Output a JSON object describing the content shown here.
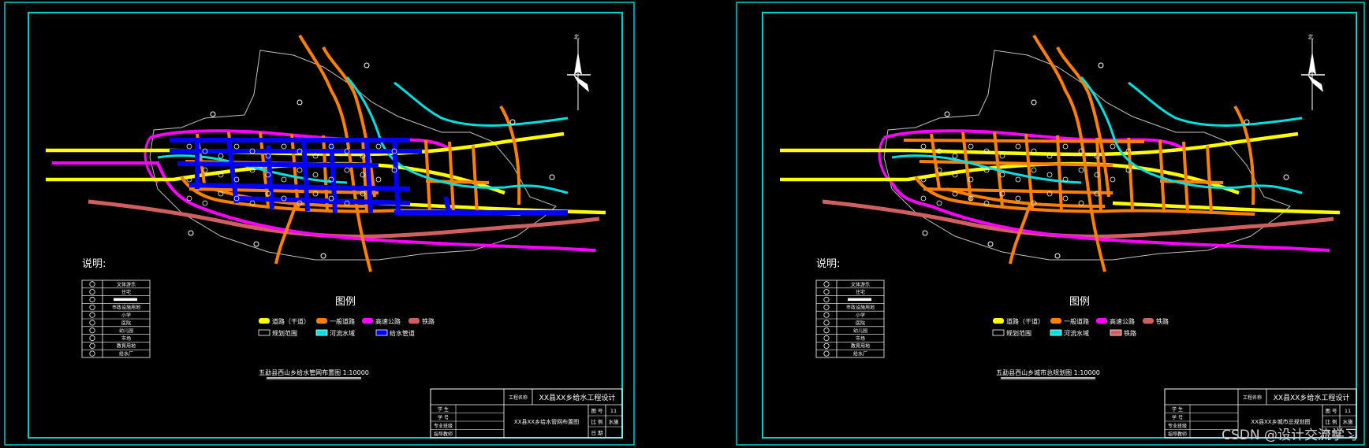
{
  "colors": {
    "frame": "#00d0d0",
    "trunk_road": "#ffff00",
    "general_road": "#ff8000",
    "expressway": "#ff00ff",
    "railway": "#d06060",
    "river": "#00e0e0",
    "water_pipe": "#0000ff",
    "boundary": "#c0c0c0"
  },
  "compass_label": "北",
  "notes_label": "说明:",
  "legend_title": "图例",
  "legend_items": {
    "trunk_road": "道路（干道）",
    "general_road": "一般道路",
    "expressway": "高速公路",
    "railway": "铁路",
    "boundary": "规划范围",
    "river": "河流水域",
    "water_pipe": "给水管道"
  },
  "facility_list": [
    "文体游乐",
    "住宅",
    "",
    "市政设施用地",
    "小学",
    "医院",
    "幼儿园",
    "市场",
    "教育用地",
    "给水厂"
  ],
  "left_sheet": {
    "drawing_caption": "五勐县西山乡给水管网布置图 1:10000",
    "project_label": "工程名称",
    "project_name": "XX县XX乡给水工程设计",
    "drawing_name": "XX县XX乡给水管网布置图",
    "roles": [
      "学 生",
      "学 号",
      "专业班级",
      "指导教师"
    ],
    "meta_labels": [
      "图 号",
      "比 例",
      "日 期"
    ],
    "meta_values": [
      "11",
      "水施",
      ""
    ]
  },
  "right_sheet": {
    "drawing_caption": "五勐县西山乡城市总规划图 1:10000",
    "project_label": "工程名称",
    "project_name": "XX县XX乡给水工程设计",
    "drawing_name": "XX县XX乡城市总规划图",
    "roles": [
      "学 生",
      "学 号",
      "专业班级",
      "指导教师"
    ],
    "meta_labels": [
      "图 号",
      "比 例",
      "日 期"
    ],
    "meta_values": [
      "11",
      "水施",
      ""
    ]
  },
  "watermark": "CSDN @设计交流学习"
}
